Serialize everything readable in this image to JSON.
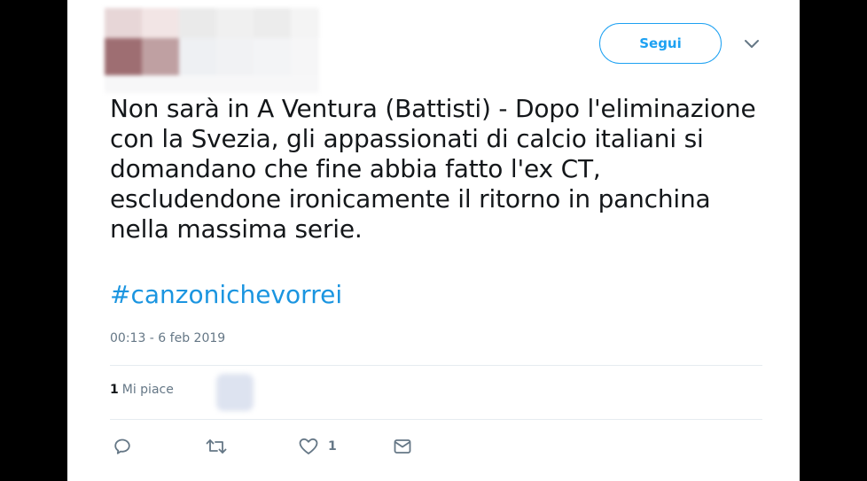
{
  "header": {
    "follow_label": "Segui"
  },
  "tweet": {
    "text": "Non sarà in A Ventura (Battisti) - Dopo l'eliminazione con la Svezia, gli appassionati di calcio italiani si domandano che fine abbia fatto l'ex CT, escludendone ironicamente il ritorno in panchina nella massima serie.",
    "hashtag": "#canzonichevorrei",
    "timestamp": "00:13 - 6 feb 2019"
  },
  "stats": {
    "likes_count": "1",
    "likes_label": "Mi piace"
  },
  "actions": {
    "like_count": "1",
    "icons": [
      "reply-icon",
      "retweet-icon",
      "heart-icon",
      "message-icon"
    ]
  },
  "colors": {
    "accent": "#1da1f2",
    "hashtag": "#1b95e0",
    "text": "#14171a",
    "muted": "#657786",
    "divider": "#e6ecf0"
  }
}
